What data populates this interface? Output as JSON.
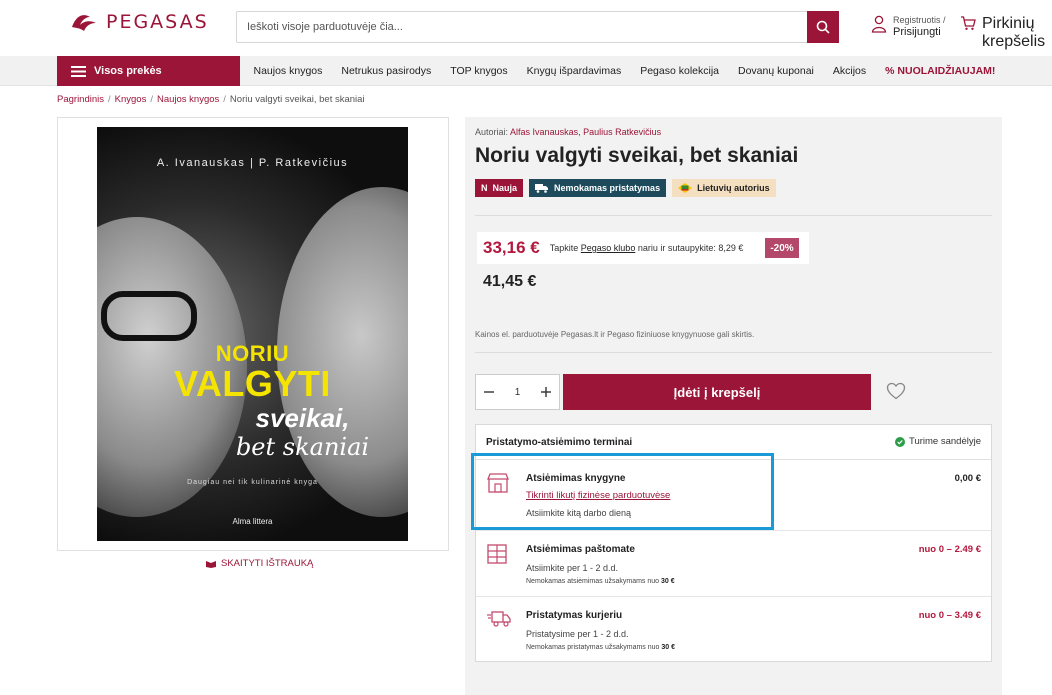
{
  "header": {
    "logo_text": "PEGASAS",
    "search_placeholder": "Ieškoti visoje parduotuvėje čia...",
    "account_line1": "Registruotis /",
    "account_line2": "Prisijungti",
    "cart_line1": "Pirkinių",
    "cart_line2": "krepšelis"
  },
  "nav": {
    "all_products": "Visos prekės",
    "links": [
      "Naujos knygos",
      "Netrukus pasirodys",
      "TOP knygos",
      "Knygų išpardavimas",
      "Pegaso kolekcija",
      "Dovanų kuponai",
      "Akcijos",
      "% NUOLAIDŽIAUJAM!"
    ]
  },
  "breadcrumb": {
    "items": [
      "Pagrindinis",
      "Knygos",
      "Naujos knygos"
    ],
    "current": "Noriu valgyti sveikai, bet skaniai"
  },
  "cover": {
    "authors": "A. Ivanauskas  |  P. Ratkevičius",
    "title1": "NORIU",
    "title2": "VALGYTI",
    "title3": "sveikai,",
    "title4": "bet skaniai",
    "subtitle": "Daugiau nei tik kulinarinė knyga",
    "publisher": "Alma littera"
  },
  "read_excerpt": "SKAITYTI IŠTRAUKĄ",
  "product": {
    "authors_label": "Autoriai:",
    "authors": "Alfas Ivanauskas, Paulius Ratkevičius",
    "title": "Noriu valgyti sveikai, bet skaniai",
    "badges": {
      "new_icon": "N",
      "new": "Nauja",
      "shipping": "Nemokamas pristatymas",
      "lithuanian": "Lietuvių autorius"
    },
    "club_price": "33,16 €",
    "club_text_pre": "Tapkite",
    "club_link": "Pegaso klubo",
    "club_text_post": "nariu ir sutaupykite: 8,29 €",
    "discount": "-20%",
    "regular_price": "41,45 €",
    "price_note": "Kainos el. parduotuvėje Pegasas.lt ir Pegaso fiziniuose knygynuose gali skirtis.",
    "quantity": "1",
    "add_to_cart": "Įdėti į krepšelį"
  },
  "delivery": {
    "title": "Pristatymo-atsiėmimo terminai",
    "stock": "Turime sandėlyje",
    "options": [
      {
        "name": "Atsiėmimas knygyne",
        "price": "0,00 €",
        "link": "Tikrinti likutį fizinėse parduotuvėse",
        "line2": "Atsiimkite kitą darbo dieną",
        "line3": ""
      },
      {
        "name": "Atsiėmimas paštomate",
        "price": "nuo 0 – 2.49 €",
        "line2": "Atsiimkite per 1 - 2 d.d.",
        "line3": "Nemokamas atsiėmimas užsakymams nuo",
        "line3_bold": "30 €"
      },
      {
        "name": "Pristatymas kurjeriu",
        "price": "nuo 0 – 3.49 €",
        "line2": "Pristatysime per 1 - 2 d.d.",
        "line3": "Nemokamas pristatymas užsakymams nuo",
        "line3_bold": "30 €"
      }
    ]
  },
  "colors": {
    "brand": "#9b1538",
    "price": "#b3183d",
    "highlight": "#1a9ad6"
  }
}
